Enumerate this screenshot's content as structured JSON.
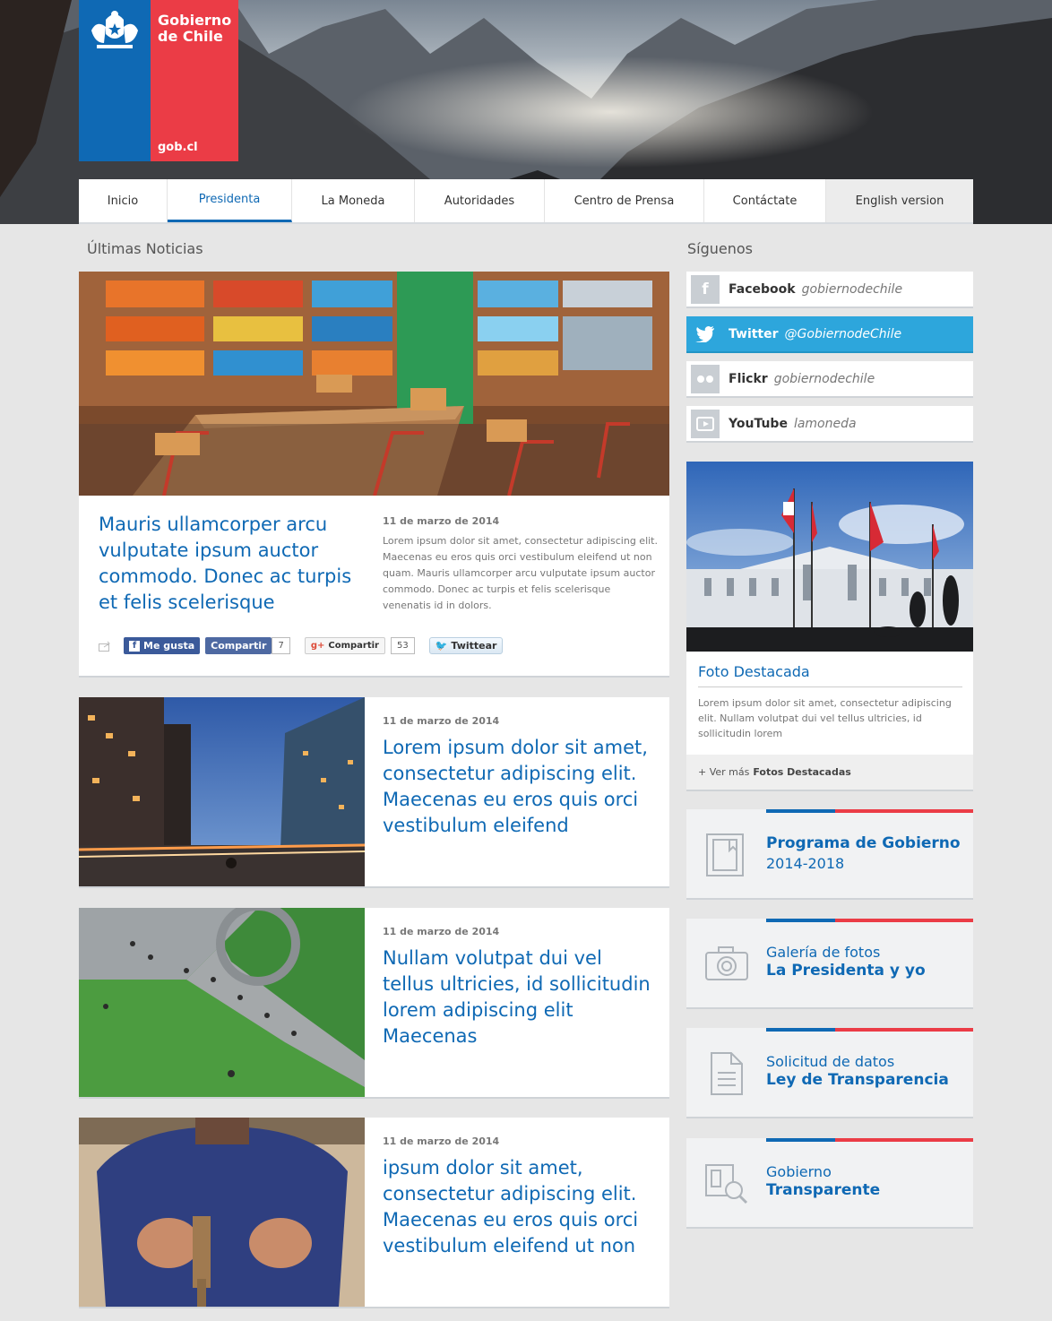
{
  "header": {
    "brand_line1": "Gobierno",
    "brand_line2": "de Chile",
    "brand_url": "gob.cl"
  },
  "nav": {
    "items": [
      {
        "label": "Inicio"
      },
      {
        "label": "Presidenta"
      },
      {
        "label": "La Moneda"
      },
      {
        "label": "Autoridades"
      },
      {
        "label": "Centro de Prensa"
      },
      {
        "label": "Contáctate"
      },
      {
        "label": "English version"
      }
    ],
    "active": "Presidenta"
  },
  "news": {
    "section_title": "Últimas Noticias",
    "featured": {
      "title": "Mauris ullamcorper arcu vulputate ipsum auctor commodo. Donec ac turpis et felis scelerisque",
      "date": "11 de marzo de 2014",
      "excerpt": "Lorem ipsum dolor sit amet, consectetur adipiscing elit. Maecenas eu eros quis orci vestibulum eleifend ut non quam. Mauris ullamcorper arcu vulputate ipsum auctor commodo. Donec ac turpis et felis scelerisque venenatis id in dolors.",
      "share": {
        "fb_like": "Me gusta",
        "fb_share": "Compartir",
        "fb_count": "7",
        "gplus_share": "Compartir",
        "gplus_count": "53",
        "tweet": "Twittear"
      }
    },
    "items": [
      {
        "date": "11 de marzo de 2014",
        "title": "Lorem ipsum dolor sit amet, consectetur adipiscing elit. Maecenas eu eros quis orci vestibulum eleifend"
      },
      {
        "date": "11 de marzo de 2014",
        "title": "Nullam volutpat dui vel tellus ultricies, id sollicitudin lorem adipiscing elit Maecenas"
      },
      {
        "date": "11 de marzo de 2014",
        "title": "ipsum dolor sit amet, consectetur adipiscing elit. Maecenas eu eros quis orci vestibulum eleifend ut non"
      }
    ]
  },
  "sidebar": {
    "follow_title": "Síguenos",
    "social": [
      {
        "name": "Facebook",
        "handle": "gobiernodechile",
        "icon": "facebook-icon"
      },
      {
        "name": "Twitter",
        "handle": "@GobiernodeChile",
        "icon": "twitter-icon"
      },
      {
        "name": "Flickr",
        "handle": "gobiernodechile",
        "icon": "flickr-icon"
      },
      {
        "name": "YouTube",
        "handle": "lamoneda",
        "icon": "youtube-icon"
      }
    ],
    "photo": {
      "title": "Foto Destacada",
      "description": "Lorem ipsum dolor sit amet, consectetur adipiscing elit. Nullam volutpat dui vel tellus ultricies, id sollicitudin lorem",
      "more_prefix": "+ Ver más",
      "more_bold": "Fotos Destacadas"
    },
    "promos": [
      {
        "line1": "Programa de Gobierno",
        "line2": "2014-2018",
        "icon": "document-icon"
      },
      {
        "line1": "Galería de fotos",
        "line2": "La Presidenta y yo",
        "icon": "camera-icon"
      },
      {
        "line1": "Solicitud de datos",
        "line2": "Ley de Transparencia",
        "icon": "file-icon"
      },
      {
        "line1": "Gobierno",
        "line2": "Transparente",
        "icon": "magnifier-document-icon"
      }
    ]
  },
  "colors": {
    "brand_blue": "#0f69b4",
    "brand_red": "#eb3c46",
    "twitter_blue": "#2da6dc",
    "background": "#e6e6e6"
  }
}
